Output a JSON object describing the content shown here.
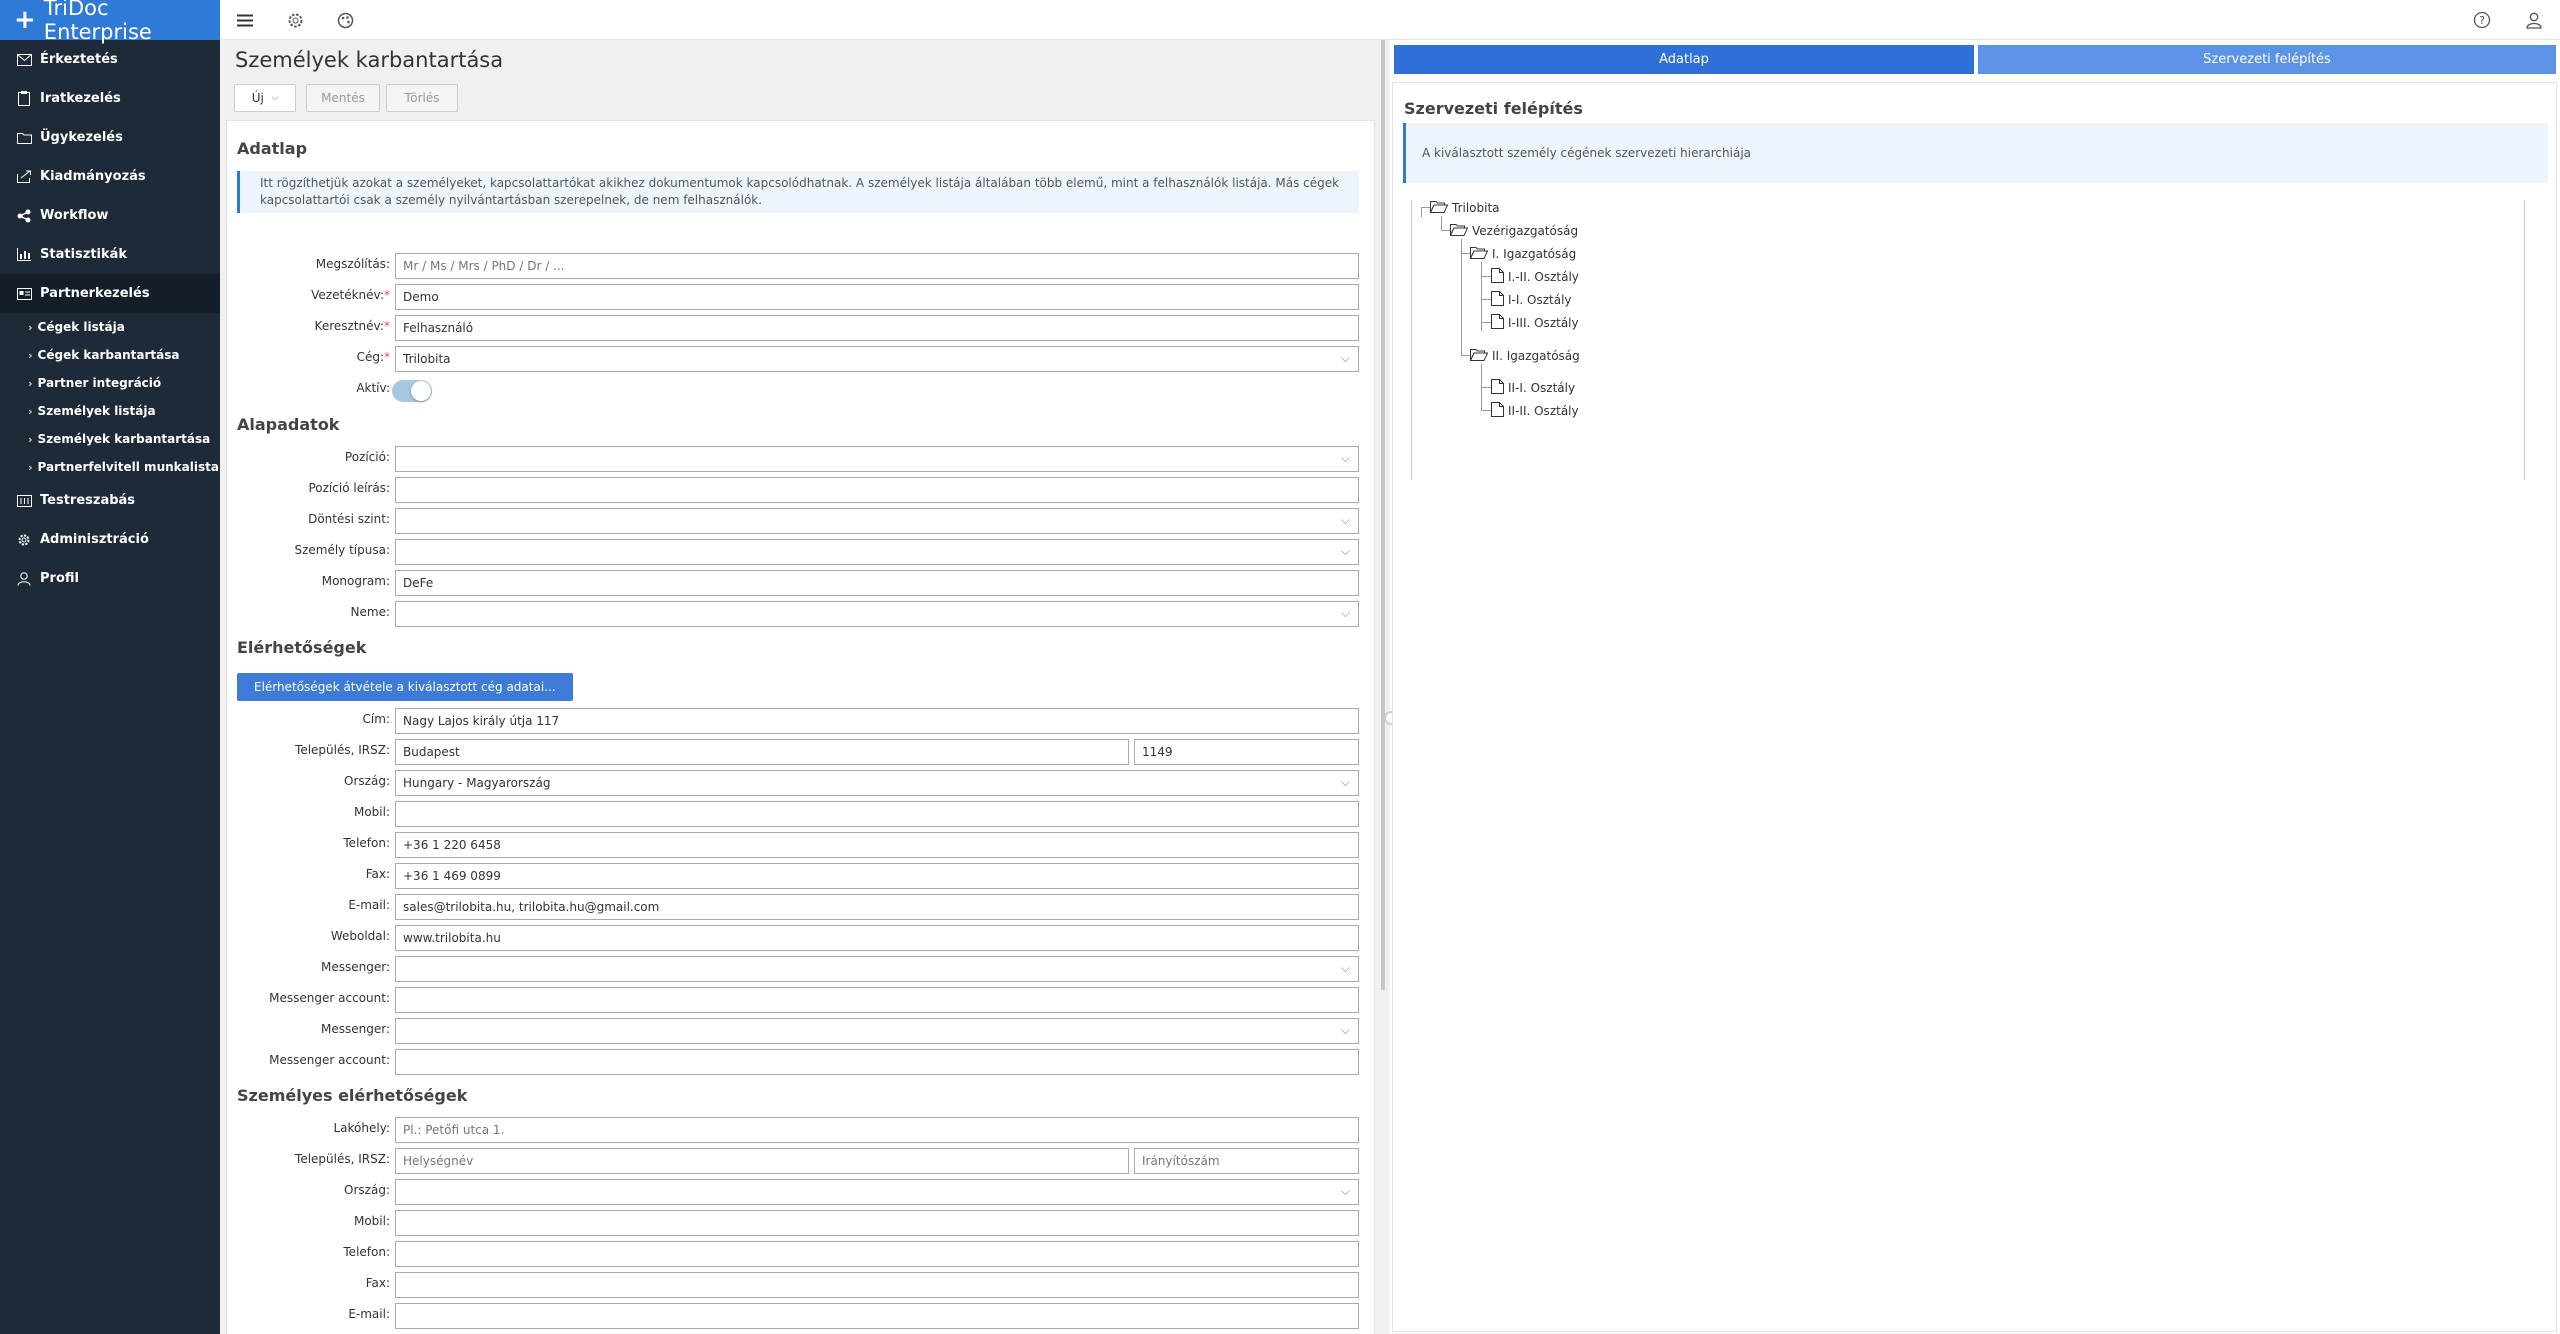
{
  "app": {
    "title": "TriDoc Enterprise"
  },
  "sidebar": {
    "items": [
      {
        "label": "Érkeztetés",
        "icon": "envelope-icon"
      },
      {
        "label": "Iratkezelés",
        "icon": "clipboard-icon"
      },
      {
        "label": "Ügykezelés",
        "icon": "folder-icon"
      },
      {
        "label": "Kiadmányozás",
        "icon": "export-icon"
      },
      {
        "label": "Workflow",
        "icon": "share-icon"
      },
      {
        "label": "Statisztikák",
        "icon": "chart-icon"
      },
      {
        "label": "Partnerkezelés",
        "icon": "card-icon"
      }
    ],
    "subitems": [
      "Cégek listája",
      "Cégek karbantartása",
      "Partner integráció",
      "Személyek listája",
      "Személyek karbantartása",
      "Partnerfelvitell munkalista"
    ],
    "bottom_items": [
      {
        "label": "Testreszabás",
        "icon": "customize-icon"
      },
      {
        "label": "Adminisztráció",
        "icon": "gear-icon"
      },
      {
        "label": "Profil",
        "icon": "user-icon"
      }
    ]
  },
  "page": {
    "title": "Személyek karbantartása"
  },
  "toolbar": {
    "new_label": "Új",
    "save_label": "Mentés",
    "delete_label": "Törlés"
  },
  "sections": {
    "adatlap": "Adatlap",
    "alapadatok": "Alapadatok",
    "elerhetosegek": "Elérhetőségek",
    "szemelyes": "Személyes elérhetőségek"
  },
  "info_text": "Itt rögzíthetjük azokat a személyeket, kapcsolattartókat akikhez dokumentumok kapcsolódhatnak. A személyek listája általában több elemű, mint a felhasználók listája. Más cégek kapcsolattartói csak a személy nyilvántartásban szerepelnek, de nem felhasználók.",
  "form": {
    "megszolitas": {
      "label": "Megszólítás:",
      "placeholder": "Mr / Ms / Mrs / PhD / Dr / ..."
    },
    "vezeteknev": {
      "label": "Vezetéknév:",
      "value": "Demo"
    },
    "keresztnev": {
      "label": "Keresztnév:",
      "value": "Felhasználó"
    },
    "ceg": {
      "label": "Cég:",
      "value": "Trilobita"
    },
    "aktiv": {
      "label": "Aktív:"
    },
    "pozicio": {
      "label": "Pozíció:"
    },
    "pozicio_leiras": {
      "label": "Pozíció leírás:"
    },
    "dontesi_szint": {
      "label": "Döntési szint:"
    },
    "szemely_tipusa": {
      "label": "Személy típusa:"
    },
    "monogram": {
      "label": "Monogram:",
      "value": "DeFe"
    },
    "neme": {
      "label": "Neme:"
    },
    "copy_button": "Elérhetőségek átvétele a kiválasztott cég adatai...",
    "cim": {
      "label": "Cím:",
      "value": "Nagy Lajos király útja 117"
    },
    "telepules": {
      "label": "Település, IRSZ:",
      "value": "Budapest",
      "zip": "1149"
    },
    "orszag": {
      "label": "Ország:",
      "value": "Hungary - Magyarország"
    },
    "mobil": {
      "label": "Mobil:"
    },
    "telefon": {
      "label": "Telefon:",
      "value": "+36 1 220 6458"
    },
    "fax": {
      "label": "Fax:",
      "value": "+36 1 469 0899"
    },
    "email": {
      "label": "E-mail:",
      "value": "sales@trilobita.hu, trilobita.hu@gmail.com"
    },
    "weboldal": {
      "label": "Weboldal:",
      "value": "www.trilobita.hu"
    },
    "messenger1": {
      "label": "Messenger:"
    },
    "messenger_account1": {
      "label": "Messenger account:"
    },
    "messenger2": {
      "label": "Messenger:"
    },
    "messenger_account2": {
      "label": "Messenger account:"
    },
    "lakohely": {
      "label": "Lakóhely:",
      "placeholder": "Pl.: Petőfi utca 1."
    },
    "p_telepules": {
      "label": "Település, IRSZ:",
      "placeholder": "Helységnév",
      "zip_placeholder": "Irányítószám"
    },
    "p_orszag": {
      "label": "Ország:"
    },
    "p_mobil": {
      "label": "Mobil:"
    },
    "p_telefon": {
      "label": "Telefon:"
    },
    "p_fax": {
      "label": "Fax:"
    },
    "p_email": {
      "label": "E-mail:"
    }
  },
  "right": {
    "tab_adatlap": "Adatlap",
    "tab_szervezeti": "Szervezeti felépítés",
    "title": "Szervezeti felépítés",
    "info": "A kiválasztott személy cégének szervezeti hierarchiája",
    "tree": [
      "Trilobita",
      "Vezérigazgatóság",
      "I. Igazgatóság",
      "I.-II. Osztály",
      "I-I. Osztály",
      "I-III. Osztály",
      "II. Igazgatóság",
      "II-I. Osztály",
      "II-II. Osztály"
    ]
  }
}
